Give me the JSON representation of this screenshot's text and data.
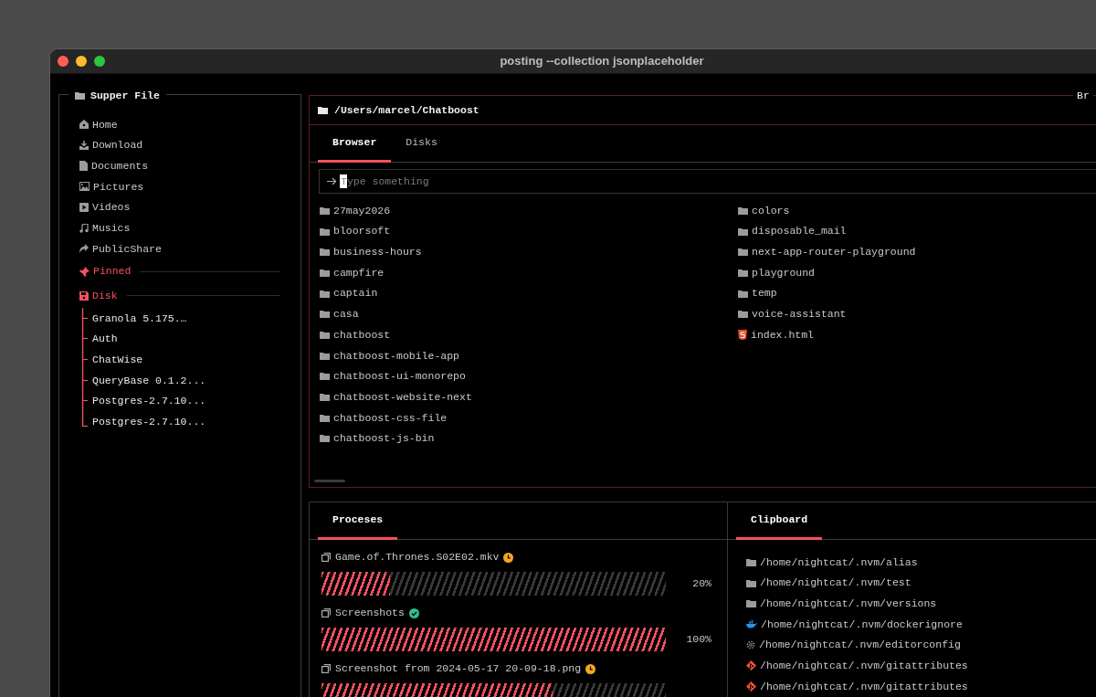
{
  "window": {
    "title": "posting --collection jsonplaceholder"
  },
  "sidebar": {
    "title": "Supper File",
    "items": [
      {
        "label": "Home",
        "kind": "home"
      },
      {
        "label": "Download",
        "kind": "download"
      },
      {
        "label": "Documents",
        "kind": "document"
      },
      {
        "label": "Pictures",
        "kind": "picture"
      },
      {
        "label": "Videos",
        "kind": "video"
      },
      {
        "label": "Musics",
        "kind": "music"
      },
      {
        "label": "PublicShare",
        "kind": "share"
      }
    ],
    "pinned": {
      "label": "Pinned"
    },
    "disk": {
      "label": "Disk",
      "items": [
        "Granola 5.175.…",
        "Auth",
        "ChatWise",
        "QueryBase 0.1.2...",
        "Postgres-2.7.10...",
        "Postgres-2.7.10..."
      ]
    }
  },
  "browser": {
    "path": "/Users/marcel/Chatboost",
    "corner_title": "Br",
    "tabs": [
      {
        "label": "Browser",
        "selected": true
      },
      {
        "label": "Disks",
        "selected": false
      }
    ],
    "search": {
      "placeholder": "Type something"
    },
    "entries": [
      {
        "name": "27may2026",
        "kind": "folder"
      },
      {
        "name": "bloorsoft",
        "kind": "folder"
      },
      {
        "name": "business-hours",
        "kind": "folder"
      },
      {
        "name": "campfire",
        "kind": "folder"
      },
      {
        "name": "captain",
        "kind": "folder"
      },
      {
        "name": "casa",
        "kind": "folder"
      },
      {
        "name": "chatboost",
        "kind": "folder"
      },
      {
        "name": "chatboost-mobile-app",
        "kind": "folder"
      },
      {
        "name": "chatboost-ui-monorepo",
        "kind": "folder"
      },
      {
        "name": "chatboost-website-next",
        "kind": "folder"
      },
      {
        "name": "chatboost-css-file",
        "kind": "folder"
      },
      {
        "name": "chatboost-js-bin",
        "kind": "folder"
      },
      {
        "name": "colors",
        "kind": "folder"
      },
      {
        "name": "disposable_mail",
        "kind": "folder"
      },
      {
        "name": "next-app-router-playground",
        "kind": "folder"
      },
      {
        "name": "playground",
        "kind": "folder"
      },
      {
        "name": "temp",
        "kind": "folder"
      },
      {
        "name": "voice-assistant",
        "kind": "folder"
      },
      {
        "name": "index.html",
        "kind": "html"
      }
    ]
  },
  "processes": {
    "tabs": [
      {
        "label": "Proceses",
        "selected": true
      }
    ],
    "items": [
      {
        "name": "Game.of.Thrones.S02E02.mkv",
        "kind": "pending",
        "level": 0.2,
        "reading": "20%"
      },
      {
        "name": "Screenshots",
        "kind": "done",
        "level": 1,
        "reading": "100%"
      },
      {
        "name": "Screenshot from 2024-05-17 20-09-18.png",
        "kind": "pending",
        "level": 0.67
      }
    ]
  },
  "clipboard": {
    "tabs": [
      {
        "label": "Clipboard",
        "selected": true
      }
    ],
    "items": [
      {
        "path": "/home/nightcat/.nvm/alias",
        "kind": "folder"
      },
      {
        "path": "/home/nightcat/.nvm/test",
        "kind": "folder"
      },
      {
        "path": "/home/nightcat/.nvm/versions",
        "kind": "folder"
      },
      {
        "path": "/home/nightcat/.nvm/dockerignore",
        "kind": "docker"
      },
      {
        "path": "/home/nightcat/.nvm/editorconfig",
        "kind": "config"
      },
      {
        "path": "/home/nightcat/.nvm/gitattributes",
        "kind": "git"
      },
      {
        "path": "/home/nightcat/.nvm/gitattributes",
        "kind": "git"
      }
    ]
  }
}
